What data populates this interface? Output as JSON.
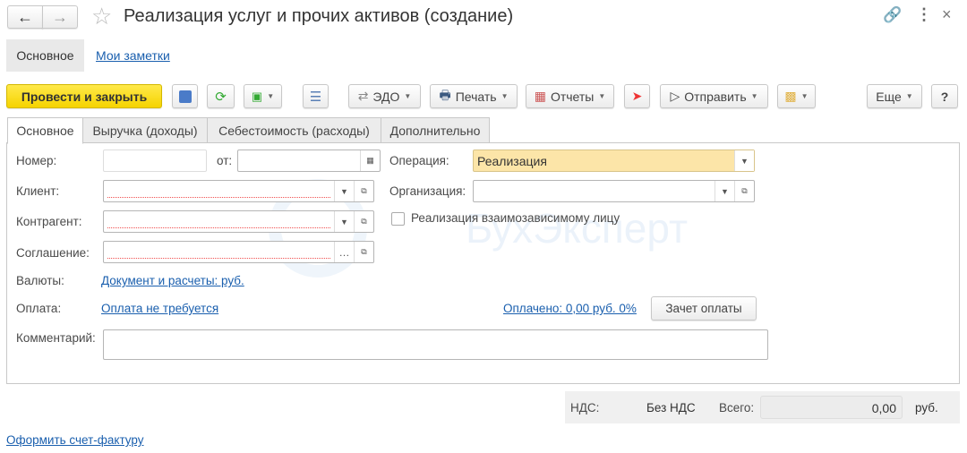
{
  "window": {
    "title": "Реализация услуг и прочих активов (создание)"
  },
  "nav": {
    "main": "Основное",
    "notes": "Мои заметки"
  },
  "toolbar": {
    "post_close": "Провести и закрыть",
    "edo": "ЭДО",
    "print": "Печать",
    "reports": "Отчеты",
    "send": "Отправить",
    "more": "Еще",
    "help": "?"
  },
  "tabs": [
    "Основное",
    "Выручка (доходы)",
    "Себестоимость (расходы)",
    "Дополнительно"
  ],
  "form": {
    "number_label": "Номер:",
    "number_value": "",
    "date_label": "от:",
    "date_value": "",
    "client_label": "Клиент:",
    "contractor_label": "Контрагент:",
    "agreement_label": "Соглашение:",
    "operation_label": "Операция:",
    "operation_value": "Реализация",
    "organization_label": "Организация:",
    "related_party_label": "Реализация взаимозависимому лицу",
    "currency_label": "Валюты:",
    "currency_link": "Документ и расчеты: руб.",
    "payment_label": "Оплата:",
    "payment_link": "Оплата не требуется",
    "paid_link": "Оплачено: 0,00 руб. 0%",
    "offset_button": "Зачет оплаты",
    "comment_label": "Комментарий:",
    "comment_value": ""
  },
  "footer": {
    "vat_label": "НДС:",
    "vat_value": "Без НДС",
    "total_label": "Всего:",
    "total_value": "0,00",
    "currency": "руб."
  },
  "invoice_link": "Оформить счет-фактуру",
  "watermark": "БухЭксперт"
}
